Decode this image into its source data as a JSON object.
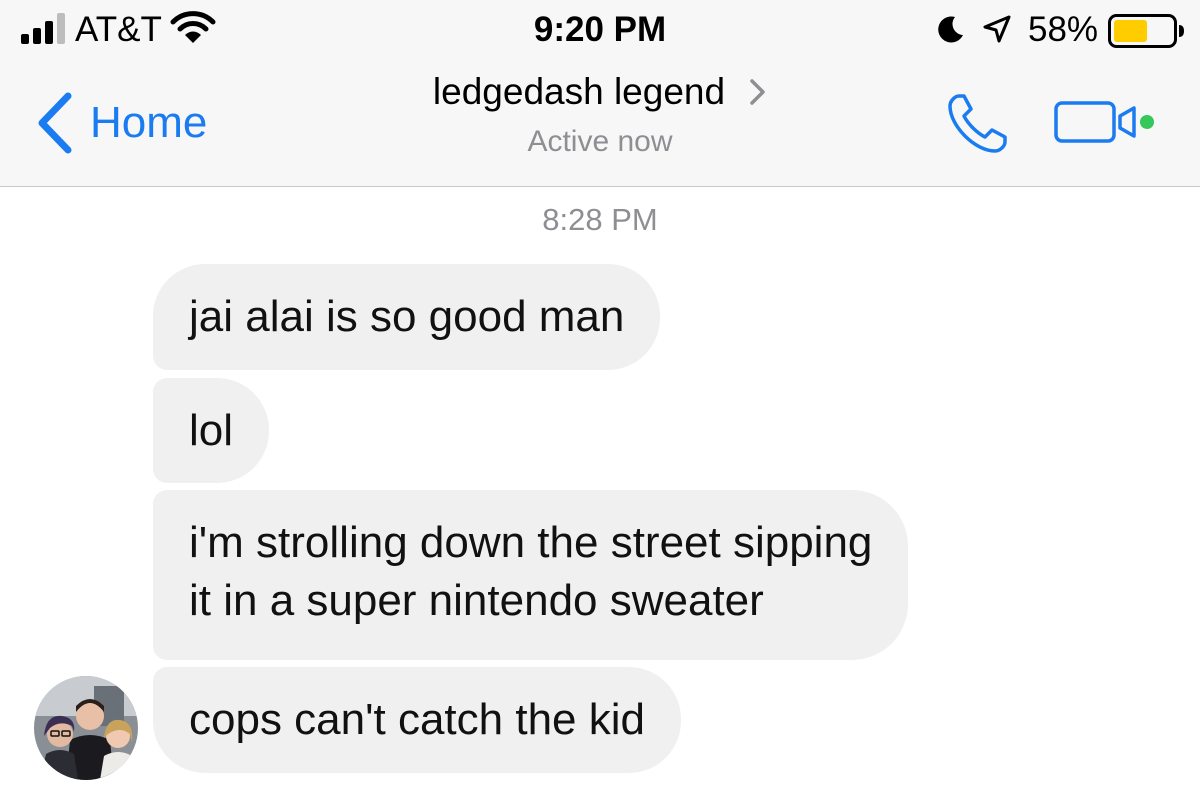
{
  "status_bar": {
    "carrier": "AT&T",
    "time": "9:20 PM",
    "battery_percent_label": "58%",
    "battery_level": 0.58,
    "battery_color": "#ffcc00",
    "icons": [
      "signal-icon",
      "wifi-icon",
      "moon-icon",
      "location-arrow-icon",
      "battery-icon"
    ]
  },
  "nav": {
    "back_label": "Home",
    "contact_name": "ledgedash legend",
    "active_status": "Active now",
    "accent_color": "#1a7cf0",
    "online_dot_color": "#34c759",
    "icons": [
      "back-chevron-icon",
      "chevron-right-icon",
      "phone-icon",
      "video-camera-icon"
    ]
  },
  "conversation": {
    "timestamp": "8:28 PM",
    "messages": [
      {
        "lines": [
          "jai alai is so good man"
        ]
      },
      {
        "lines": [
          "lol"
        ]
      },
      {
        "lines": [
          "i'm strolling down the street sipping",
          "it in a super nintendo sweater"
        ]
      },
      {
        "lines": [
          "cops can't catch the kid"
        ]
      }
    ],
    "bubble_color": "#f1f0f0",
    "sender_avatar": "avatar-photo"
  }
}
